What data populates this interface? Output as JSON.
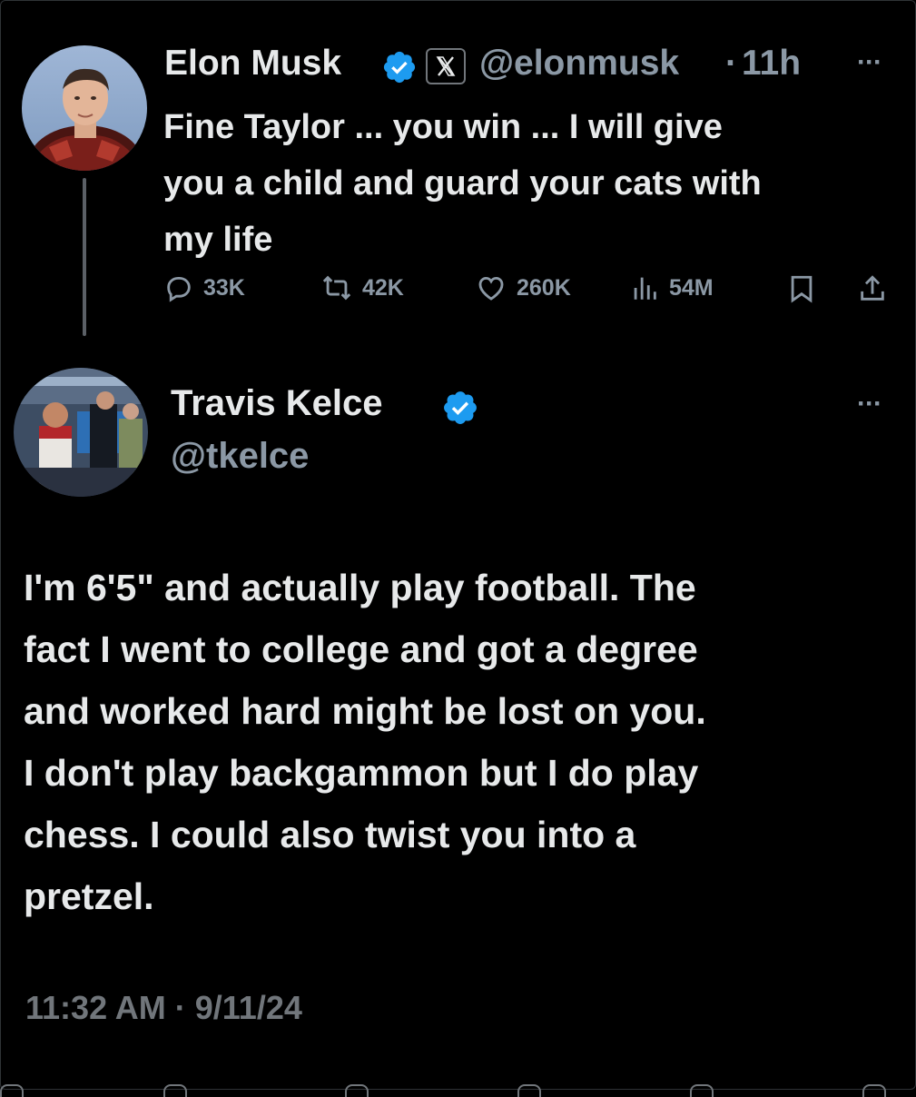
{
  "original_tweet": {
    "author_name": "Elon Musk",
    "handle": "@elonmusk",
    "separator": "·",
    "time_ago": "11h",
    "text": "Fine Taylor ... you win ... I will give\nyou a child and guard your cats with\nmy life",
    "stats": {
      "replies": "33K",
      "reposts": "42K",
      "likes": "260K",
      "views": "54M"
    },
    "more_label": "···",
    "icons": [
      "verified-badge-icon",
      "x-logo-icon",
      "reply-icon",
      "repost-icon",
      "like-icon",
      "views-icon",
      "bookmark-icon",
      "share-icon",
      "more-icon"
    ]
  },
  "reply_tweet": {
    "author_name": "Travis Kelce",
    "handle": "@tkelce",
    "more_label": "···",
    "text": "I'm 6'5\" and actually play football. The\nfact I went to college and got a degree\nand worked hard might be lost on you.\nI don't play backgammon but I do play\nchess. I could also twist you into a\npretzel.",
    "timestamp": "11:32 AM · 9/11/24"
  },
  "colors": {
    "background": "#000000",
    "text_primary": "#e7e9ea",
    "text_secondary": "#8b98a5",
    "verified_blue": "#1d9bf0",
    "thread_line": "#5b6066"
  }
}
